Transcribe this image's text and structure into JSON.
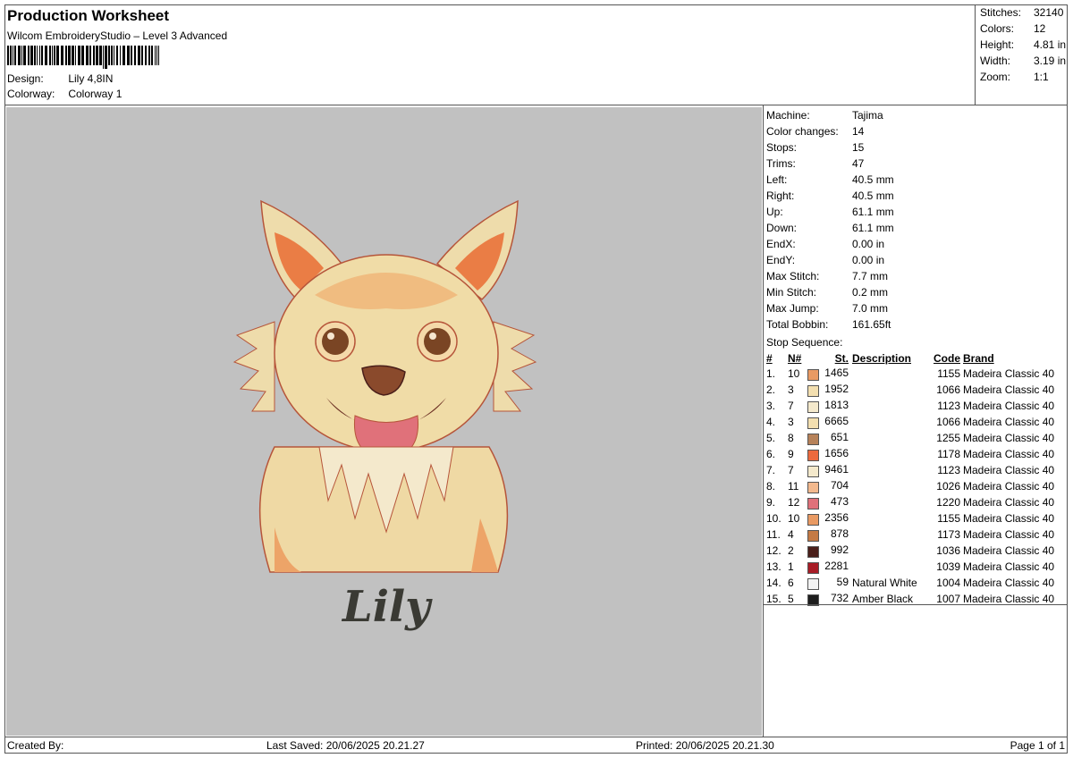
{
  "header": {
    "title": "Production Worksheet",
    "subtitle": "Wilcom EmbroideryStudio – Level 3 Advanced",
    "design_label": "Design:",
    "design_value": "Lily 4,8IN",
    "colorway_label": "Colorway:",
    "colorway_value": "Colorway 1"
  },
  "stats": [
    {
      "label": "Stitches:",
      "value": "32140"
    },
    {
      "label": "Colors:",
      "value": "12"
    },
    {
      "label": "Height:",
      "value": "4.81 in"
    },
    {
      "label": "Width:",
      "value": "3.19 in"
    },
    {
      "label": "Zoom:",
      "value": "1:1"
    }
  ],
  "machine": [
    {
      "label": "Machine:",
      "value": "Tajima"
    },
    {
      "label": "Color changes:",
      "value": "14"
    },
    {
      "label": "Stops:",
      "value": "15"
    },
    {
      "label": "Trims:",
      "value": "47"
    },
    {
      "label": "Left:",
      "value": "40.5 mm"
    },
    {
      "label": "Right:",
      "value": "40.5 mm"
    },
    {
      "label": "Up:",
      "value": "61.1 mm"
    },
    {
      "label": "Down:",
      "value": "61.1 mm"
    },
    {
      "label": "EndX:",
      "value": "0.00 in"
    },
    {
      "label": "EndY:",
      "value": "0.00 in"
    },
    {
      "label": "Max Stitch:",
      "value": "7.7 mm"
    },
    {
      "label": "Min Stitch:",
      "value": "0.2 mm"
    },
    {
      "label": "Max Jump:",
      "value": "7.0 mm"
    },
    {
      "label": "Total Bobbin:",
      "value": "161.65ft"
    }
  ],
  "sequence": {
    "label": "Stop Sequence:",
    "headers": {
      "idx": "#",
      "n": "N#",
      "st": "St.",
      "desc": "Description",
      "code": "Code",
      "brand": "Brand"
    },
    "rows": [
      {
        "idx": "1.",
        "n": "10",
        "color": "#e99a63",
        "st": "1465",
        "desc": "",
        "code": "1155",
        "brand": "Madeira Classic 40"
      },
      {
        "idx": "2.",
        "n": "3",
        "color": "#f3dfb0",
        "st": "1952",
        "desc": "",
        "code": "1066",
        "brand": "Madeira Classic 40"
      },
      {
        "idx": "3.",
        "n": "7",
        "color": "#f4e9cc",
        "st": "1813",
        "desc": "",
        "code": "1123",
        "brand": "Madeira Classic 40"
      },
      {
        "idx": "4.",
        "n": "3",
        "color": "#f3dfb0",
        "st": "6665",
        "desc": "",
        "code": "1066",
        "brand": "Madeira Classic 40"
      },
      {
        "idx": "5.",
        "n": "8",
        "color": "#b7825a",
        "st": "651",
        "desc": "",
        "code": "1255",
        "brand": "Madeira Classic 40"
      },
      {
        "idx": "6.",
        "n": "9",
        "color": "#ec6a3e",
        "st": "1656",
        "desc": "",
        "code": "1178",
        "brand": "Madeira Classic 40"
      },
      {
        "idx": "7.",
        "n": "7",
        "color": "#f4e9cc",
        "st": "9461",
        "desc": "",
        "code": "1123",
        "brand": "Madeira Classic 40"
      },
      {
        "idx": "8.",
        "n": "11",
        "color": "#f3b98e",
        "st": "704",
        "desc": "",
        "code": "1026",
        "brand": "Madeira Classic 40"
      },
      {
        "idx": "9.",
        "n": "12",
        "color": "#e0717a",
        "st": "473",
        "desc": "",
        "code": "1220",
        "brand": "Madeira Classic 40"
      },
      {
        "idx": "10.",
        "n": "10",
        "color": "#e99a63",
        "st": "2356",
        "desc": "",
        "code": "1155",
        "brand": "Madeira Classic 40"
      },
      {
        "idx": "11.",
        "n": "4",
        "color": "#c47a45",
        "st": "878",
        "desc": "",
        "code": "1173",
        "brand": "Madeira Classic 40"
      },
      {
        "idx": "12.",
        "n": "2",
        "color": "#4a1f1a",
        "st": "992",
        "desc": "",
        "code": "1036",
        "brand": "Madeira Classic 40"
      },
      {
        "idx": "13.",
        "n": "1",
        "color": "#a81c26",
        "st": "2281",
        "desc": "",
        "code": "1039",
        "brand": "Madeira Classic 40"
      },
      {
        "idx": "14.",
        "n": "6",
        "color": "#f3f3f3",
        "st": "59",
        "desc": "Natural White",
        "code": "1004",
        "brand": "Madeira Classic 40"
      },
      {
        "idx": "15.",
        "n": "5",
        "color": "#1e1e1e",
        "st": "732",
        "desc": "Amber Black",
        "code": "1007",
        "brand": "Madeira Classic 40"
      }
    ]
  },
  "design_text": "Lily",
  "footer": {
    "created_by": "Created By:",
    "last_saved": "Last Saved: 20/06/2025 20.21.27",
    "printed": "Printed: 20/06/2025 20.21.30",
    "page": "Page 1 of 1"
  },
  "colors": {
    "canvas": "#c1c1c1"
  }
}
